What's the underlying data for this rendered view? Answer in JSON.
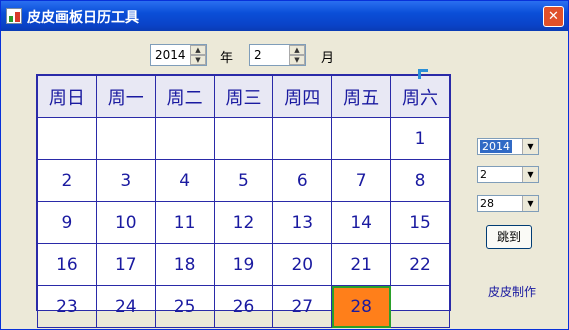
{
  "window": {
    "title": "皮皮画板日历工具",
    "close_glyph": "✕"
  },
  "year_spinner": {
    "value": "2014",
    "label": "年"
  },
  "month_spinner": {
    "value": "2",
    "label": "月"
  },
  "calendar": {
    "weekdays": [
      "周日",
      "周一",
      "周二",
      "周三",
      "周四",
      "周五",
      "周六"
    ],
    "rows": [
      [
        "",
        "",
        "",
        "",
        "",
        "",
        "1"
      ],
      [
        "2",
        "3",
        "4",
        "5",
        "6",
        "7",
        "8"
      ],
      [
        "9",
        "10",
        "11",
        "12",
        "13",
        "14",
        "15"
      ],
      [
        "16",
        "17",
        "18",
        "19",
        "20",
        "21",
        "22"
      ],
      [
        "23",
        "24",
        "25",
        "26",
        "27",
        "28",
        ""
      ]
    ],
    "highlighted_day": "28",
    "highlight_color": "#ff7f1a",
    "highlight_border": "#2aa02a"
  },
  "side": {
    "year_select": "2014",
    "month_select": "2",
    "day_select": "28",
    "jump_button": "跳到",
    "credit": "皮皮制作"
  }
}
